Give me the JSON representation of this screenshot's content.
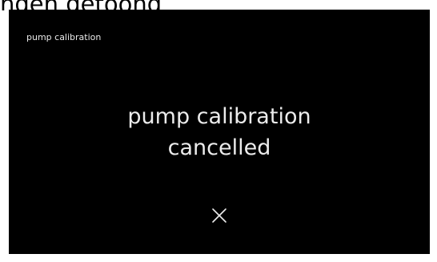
{
  "caption": "nden getoond",
  "screen": {
    "title": "pump calibration",
    "message_line1": "pump calibration",
    "message_line2": "cancelled",
    "close_icon": "close-icon",
    "colors": {
      "background": "#000000",
      "text": "#ececec"
    }
  }
}
